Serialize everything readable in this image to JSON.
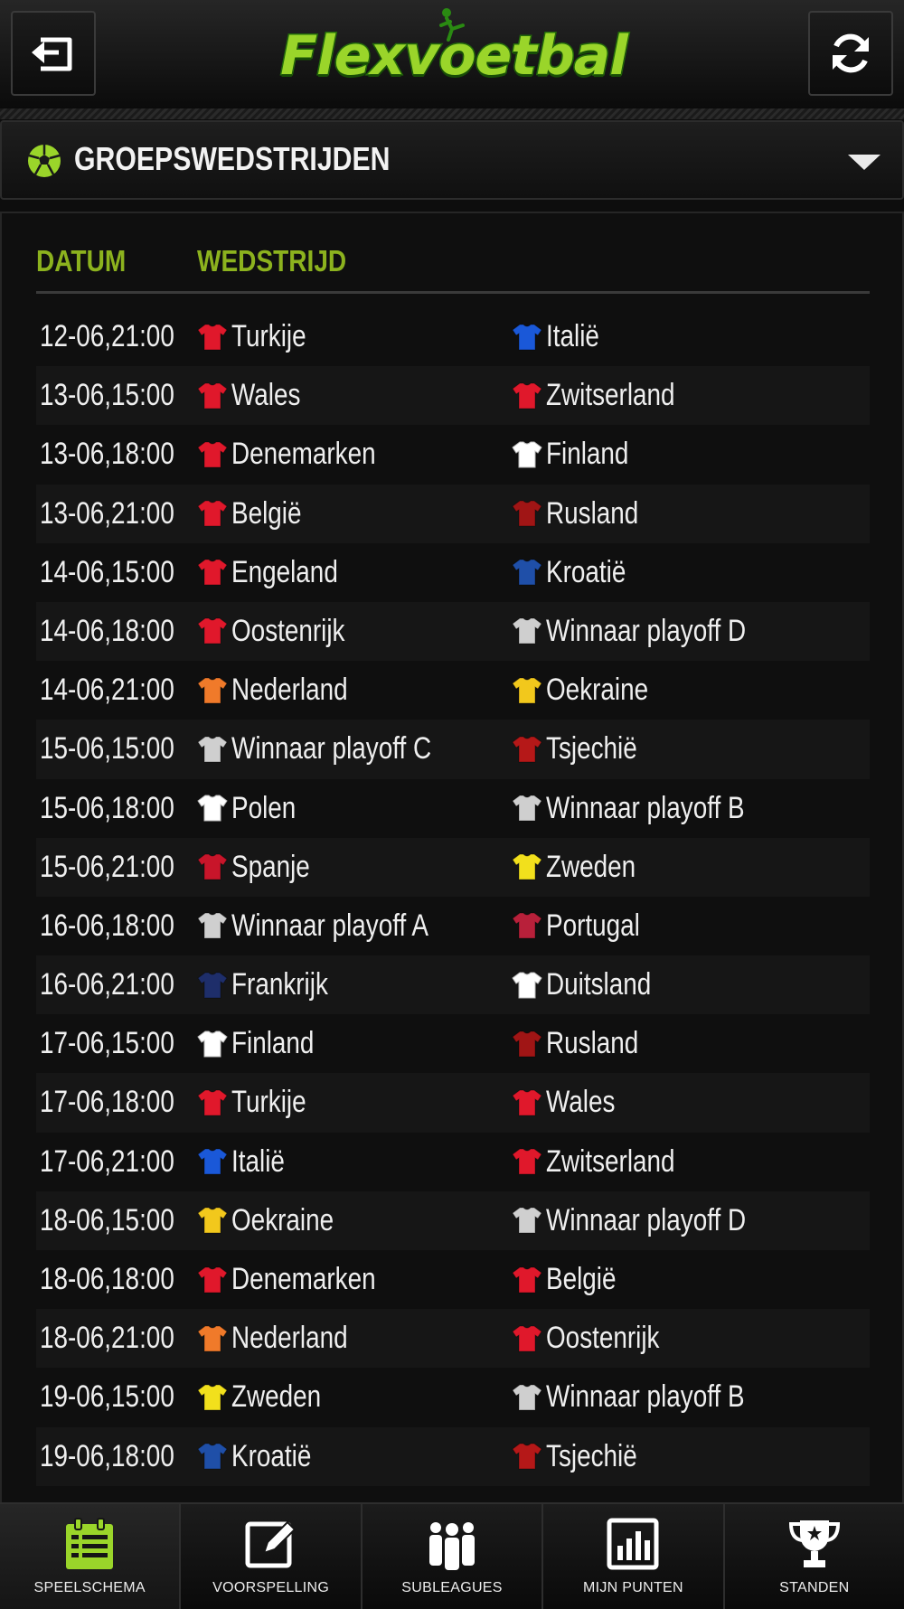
{
  "header": {
    "logo_text": "Flexvoetbal",
    "back_icon": "back-icon",
    "refresh_icon": "refresh-icon"
  },
  "section": {
    "title": "GROEPSWEDSTRIJDEN",
    "icon": "soccer-ball-icon",
    "toggle_icon": "caret-down-icon"
  },
  "table": {
    "columns": [
      "DATUM",
      "WEDSTRIJD"
    ],
    "matches": [
      {
        "date": "12-06,21:00",
        "home": "Turkije",
        "home_shirt": "#e0182b",
        "away": "Italië",
        "away_shirt": "#1a58d8"
      },
      {
        "date": "13-06,15:00",
        "home": "Wales",
        "home_shirt": "#e0182b",
        "away": "Zwitserland",
        "away_shirt": "#e0182b"
      },
      {
        "date": "13-06,18:00",
        "home": "Denemarken",
        "home_shirt": "#e0182b",
        "away": "Finland",
        "away_shirt": "#ffffff"
      },
      {
        "date": "13-06,21:00",
        "home": "België",
        "home_shirt": "#e0182b",
        "away": "Rusland",
        "away_shirt": "#a01515"
      },
      {
        "date": "14-06,15:00",
        "home": "Engeland",
        "home_shirt": "#e0182b",
        "away": "Kroatië",
        "away_shirt": "#1f4fa8"
      },
      {
        "date": "14-06,18:00",
        "home": "Oostenrijk",
        "home_shirt": "#e0182b",
        "away": "Winnaar playoff D",
        "away_shirt": "#cfcfcf"
      },
      {
        "date": "14-06,21:00",
        "home": "Nederland",
        "home_shirt": "#f07a2a",
        "away": "Oekraine",
        "away_shirt": "#f2c81c"
      },
      {
        "date": "15-06,15:00",
        "home": "Winnaar playoff C",
        "home_shirt": "#cfcfcf",
        "away": "Tsjechië",
        "away_shirt": "#b51818"
      },
      {
        "date": "15-06,18:00",
        "home": "Polen",
        "home_shirt": "#ffffff",
        "away": "Winnaar playoff B",
        "away_shirt": "#cfcfcf"
      },
      {
        "date": "15-06,21:00",
        "home": "Spanje",
        "home_shirt": "#c8152a",
        "away": "Zweden",
        "away_shirt": "#f2e01c"
      },
      {
        "date": "16-06,18:00",
        "home": "Winnaar playoff A",
        "home_shirt": "#cfcfcf",
        "away": "Portugal",
        "away_shirt": "#b8203a"
      },
      {
        "date": "16-06,21:00",
        "home": "Frankrijk",
        "home_shirt": "#1e2e6a",
        "away": "Duitsland",
        "away_shirt": "#ffffff"
      },
      {
        "date": "17-06,15:00",
        "home": "Finland",
        "home_shirt": "#ffffff",
        "away": "Rusland",
        "away_shirt": "#a01515"
      },
      {
        "date": "17-06,18:00",
        "home": "Turkije",
        "home_shirt": "#e0182b",
        "away": "Wales",
        "away_shirt": "#e0182b"
      },
      {
        "date": "17-06,21:00",
        "home": "Italië",
        "home_shirt": "#1a58d8",
        "away": "Zwitserland",
        "away_shirt": "#e0182b"
      },
      {
        "date": "18-06,15:00",
        "home": "Oekraine",
        "home_shirt": "#f2c81c",
        "away": "Winnaar playoff D",
        "away_shirt": "#cfcfcf"
      },
      {
        "date": "18-06,18:00",
        "home": "Denemarken",
        "home_shirt": "#e0182b",
        "away": "België",
        "away_shirt": "#e0182b"
      },
      {
        "date": "18-06,21:00",
        "home": "Nederland",
        "home_shirt": "#f07a2a",
        "away": "Oostenrijk",
        "away_shirt": "#e0182b"
      },
      {
        "date": "19-06,15:00",
        "home": "Zweden",
        "home_shirt": "#f2e01c",
        "away": "Winnaar playoff B",
        "away_shirt": "#cfcfcf"
      },
      {
        "date": "19-06,18:00",
        "home": "Kroatië",
        "home_shirt": "#1f4fa8",
        "away": "Tsjechië",
        "away_shirt": "#b51818"
      }
    ]
  },
  "nav": {
    "items": [
      {
        "label": "SPEELSCHEMA",
        "icon": "calendar-icon",
        "active": true
      },
      {
        "label": "VOORSPELLING",
        "icon": "edit-icon",
        "active": false
      },
      {
        "label": "SUBLEAGUES",
        "icon": "group-icon",
        "active": false
      },
      {
        "label": "MIJN PUNTEN",
        "icon": "bar-chart-icon",
        "active": false
      },
      {
        "label": "STANDEN",
        "icon": "trophy-icon",
        "active": false
      }
    ]
  },
  "colors": {
    "accent": "#8cb21e",
    "logo_green": "#9ad52a",
    "background": "#0d0d0d"
  }
}
